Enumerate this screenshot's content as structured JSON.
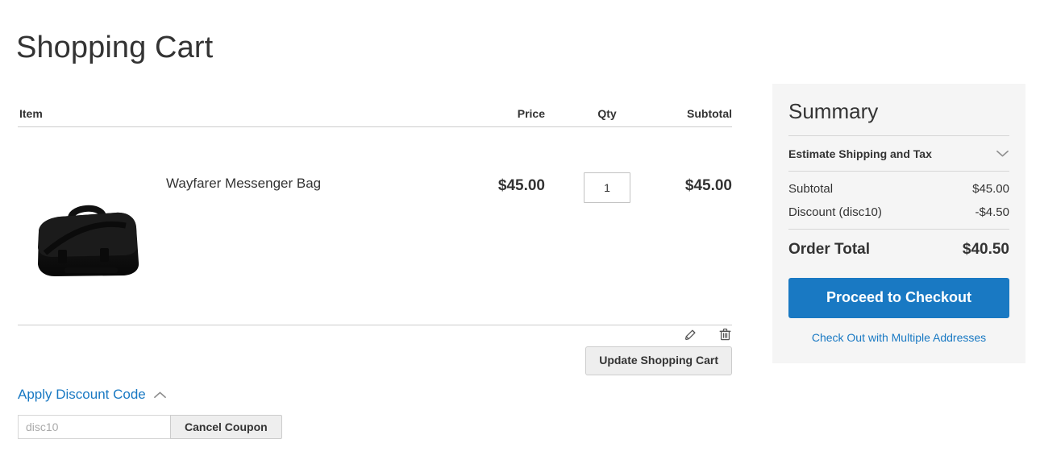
{
  "page": {
    "title": "Shopping Cart"
  },
  "cart": {
    "columns": {
      "item": "Item",
      "price": "Price",
      "qty": "Qty",
      "subtotal": "Subtotal"
    },
    "items": [
      {
        "name": "Wayfarer Messenger Bag",
        "price": "$45.00",
        "qty": "1",
        "subtotal": "$45.00",
        "image_alt": "black messenger bag"
      }
    ],
    "update_button": "Update Shopping Cart"
  },
  "discount": {
    "toggle_label": "Apply Discount Code",
    "toggle_icon": "chevron-up-icon",
    "expanded": true,
    "input_value": "",
    "input_placeholder": "disc10",
    "cancel_button": "Cancel Coupon"
  },
  "summary": {
    "title": "Summary",
    "estimate_label": "Estimate Shipping and Tax",
    "estimate_icon": "chevron-down-icon",
    "lines": [
      {
        "label": "Subtotal",
        "value": "$45.00"
      },
      {
        "label": "Discount (disc10)",
        "value": "-$4.50"
      }
    ],
    "grand_label": "Order Total",
    "grand_value": "$40.50",
    "checkout_button": "Proceed to Checkout",
    "multi_address_link": "Check Out with Multiple Addresses"
  },
  "icons": {
    "edit": "pencil-icon",
    "delete": "trash-icon"
  },
  "colors": {
    "accent": "#1979c3",
    "panel_bg": "#f5f5f5",
    "text": "#333333",
    "border": "#cccccc"
  }
}
